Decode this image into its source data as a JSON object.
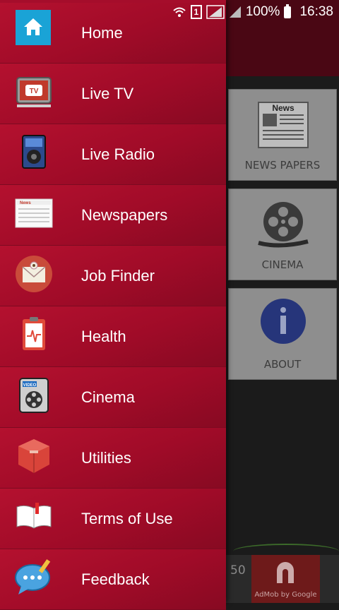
{
  "status_bar": {
    "sim_slot": "1",
    "battery": "100%",
    "time": "16:38"
  },
  "background_app": {
    "tiles": [
      {
        "label": "NEWS PAPERS",
        "icon": "newspaper-icon"
      },
      {
        "label": "CINEMA",
        "icon": "film-reel-icon"
      },
      {
        "label": "ABOUT",
        "icon": "info-icon"
      }
    ],
    "ad": {
      "count": "50",
      "text": "AdMob by Google"
    }
  },
  "drawer": {
    "items": [
      {
        "label": "Home",
        "icon": "home-icon"
      },
      {
        "label": "Live TV",
        "icon": "tv-icon"
      },
      {
        "label": "Live Radio",
        "icon": "radio-icon"
      },
      {
        "label": "Newspapers",
        "icon": "newspaper-icon"
      },
      {
        "label": "Job Finder",
        "icon": "envelope-icon"
      },
      {
        "label": "Health",
        "icon": "health-clipboard-icon"
      },
      {
        "label": "Cinema",
        "icon": "video-icon"
      },
      {
        "label": "Utilities",
        "icon": "toolbox-icon"
      },
      {
        "label": "Terms of Use",
        "icon": "book-icon"
      },
      {
        "label": "Feedback",
        "icon": "chat-bubble-icon"
      }
    ]
  },
  "colors": {
    "drawer": "#a50d2b",
    "home_icon_bg": "#1aa3d6"
  }
}
